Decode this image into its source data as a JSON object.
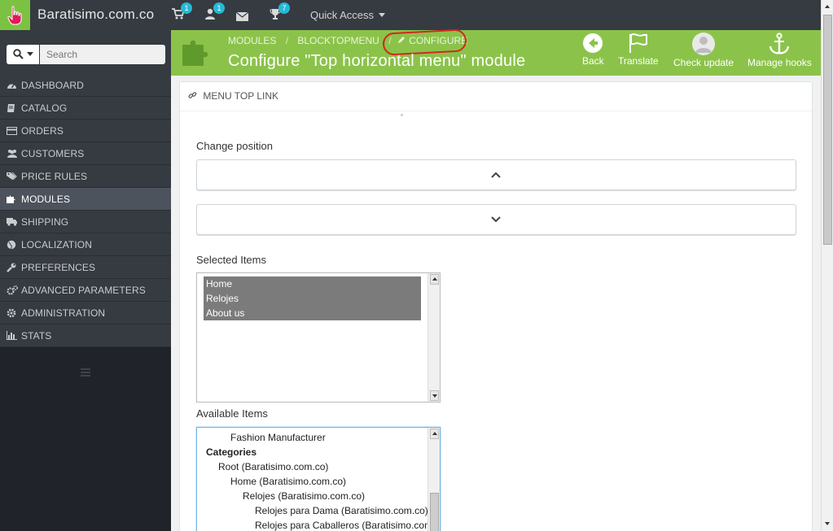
{
  "topbar": {
    "brand": "Baratisimo.com.co",
    "cart_badge": "1",
    "customers_badge": "1",
    "trophy_badge": "7",
    "quick_access": "Quick Access"
  },
  "search": {
    "placeholder": "Search"
  },
  "sidebar": {
    "items": [
      {
        "label": "DASHBOARD",
        "icon": "dashboard-icon"
      },
      {
        "label": "CATALOG",
        "icon": "book-icon"
      },
      {
        "label": "ORDERS",
        "icon": "credit-card-icon"
      },
      {
        "label": "CUSTOMERS",
        "icon": "users-icon"
      },
      {
        "label": "PRICE RULES",
        "icon": "tags-icon"
      },
      {
        "label": "MODULES",
        "icon": "puzzle-icon"
      },
      {
        "label": "SHIPPING",
        "icon": "truck-icon"
      },
      {
        "label": "LOCALIZATION",
        "icon": "globe-icon"
      },
      {
        "label": "PREFERENCES",
        "icon": "wrench-icon"
      },
      {
        "label": "ADVANCED PARAMETERS",
        "icon": "cogs-icon"
      },
      {
        "label": "ADMINISTRATION",
        "icon": "gear-icon"
      },
      {
        "label": "STATS",
        "icon": "bar-chart-icon"
      }
    ],
    "active_index": 5
  },
  "header": {
    "breadcrumbs": [
      "MODULES",
      "BLOCKTOPMENU",
      "CONFIGURE"
    ],
    "title": "Configure \"Top horizontal menu\" module",
    "toolbar": {
      "back": "Back",
      "translate": "Translate",
      "check_update": "Check update",
      "manage_hooks": "Manage hooks"
    }
  },
  "panel": {
    "heading": "MENU TOP LINK",
    "change_position_label": "Change position",
    "selected_items_label": "Selected Items",
    "selected_items": [
      "Home",
      "Relojes",
      "About us"
    ],
    "available_items_label": "Available Items",
    "available_items": [
      {
        "text": "Fashion Manufacturer",
        "indent": 2,
        "bold": false
      },
      {
        "text": "Categories",
        "indent": 0,
        "bold": true
      },
      {
        "text": "Root (Baratisimo.com.co)",
        "indent": 1,
        "bold": false
      },
      {
        "text": "Home (Baratisimo.com.co)",
        "indent": 2,
        "bold": false
      },
      {
        "text": "Relojes (Baratisimo.com.co)",
        "indent": 3,
        "bold": false
      },
      {
        "text": "Relojes para Dama (Baratisimo.com.co)",
        "indent": 4,
        "bold": false
      },
      {
        "text": "Relojes para Caballeros (Baratisimo.com.co)",
        "indent": 4,
        "bold": false
      }
    ]
  },
  "colors": {
    "topbar": "#363a41",
    "accent_green": "#8bc34a",
    "sidebar_bg": "#202329",
    "badge": "#25b9d7",
    "annotation": "#d0281e"
  }
}
